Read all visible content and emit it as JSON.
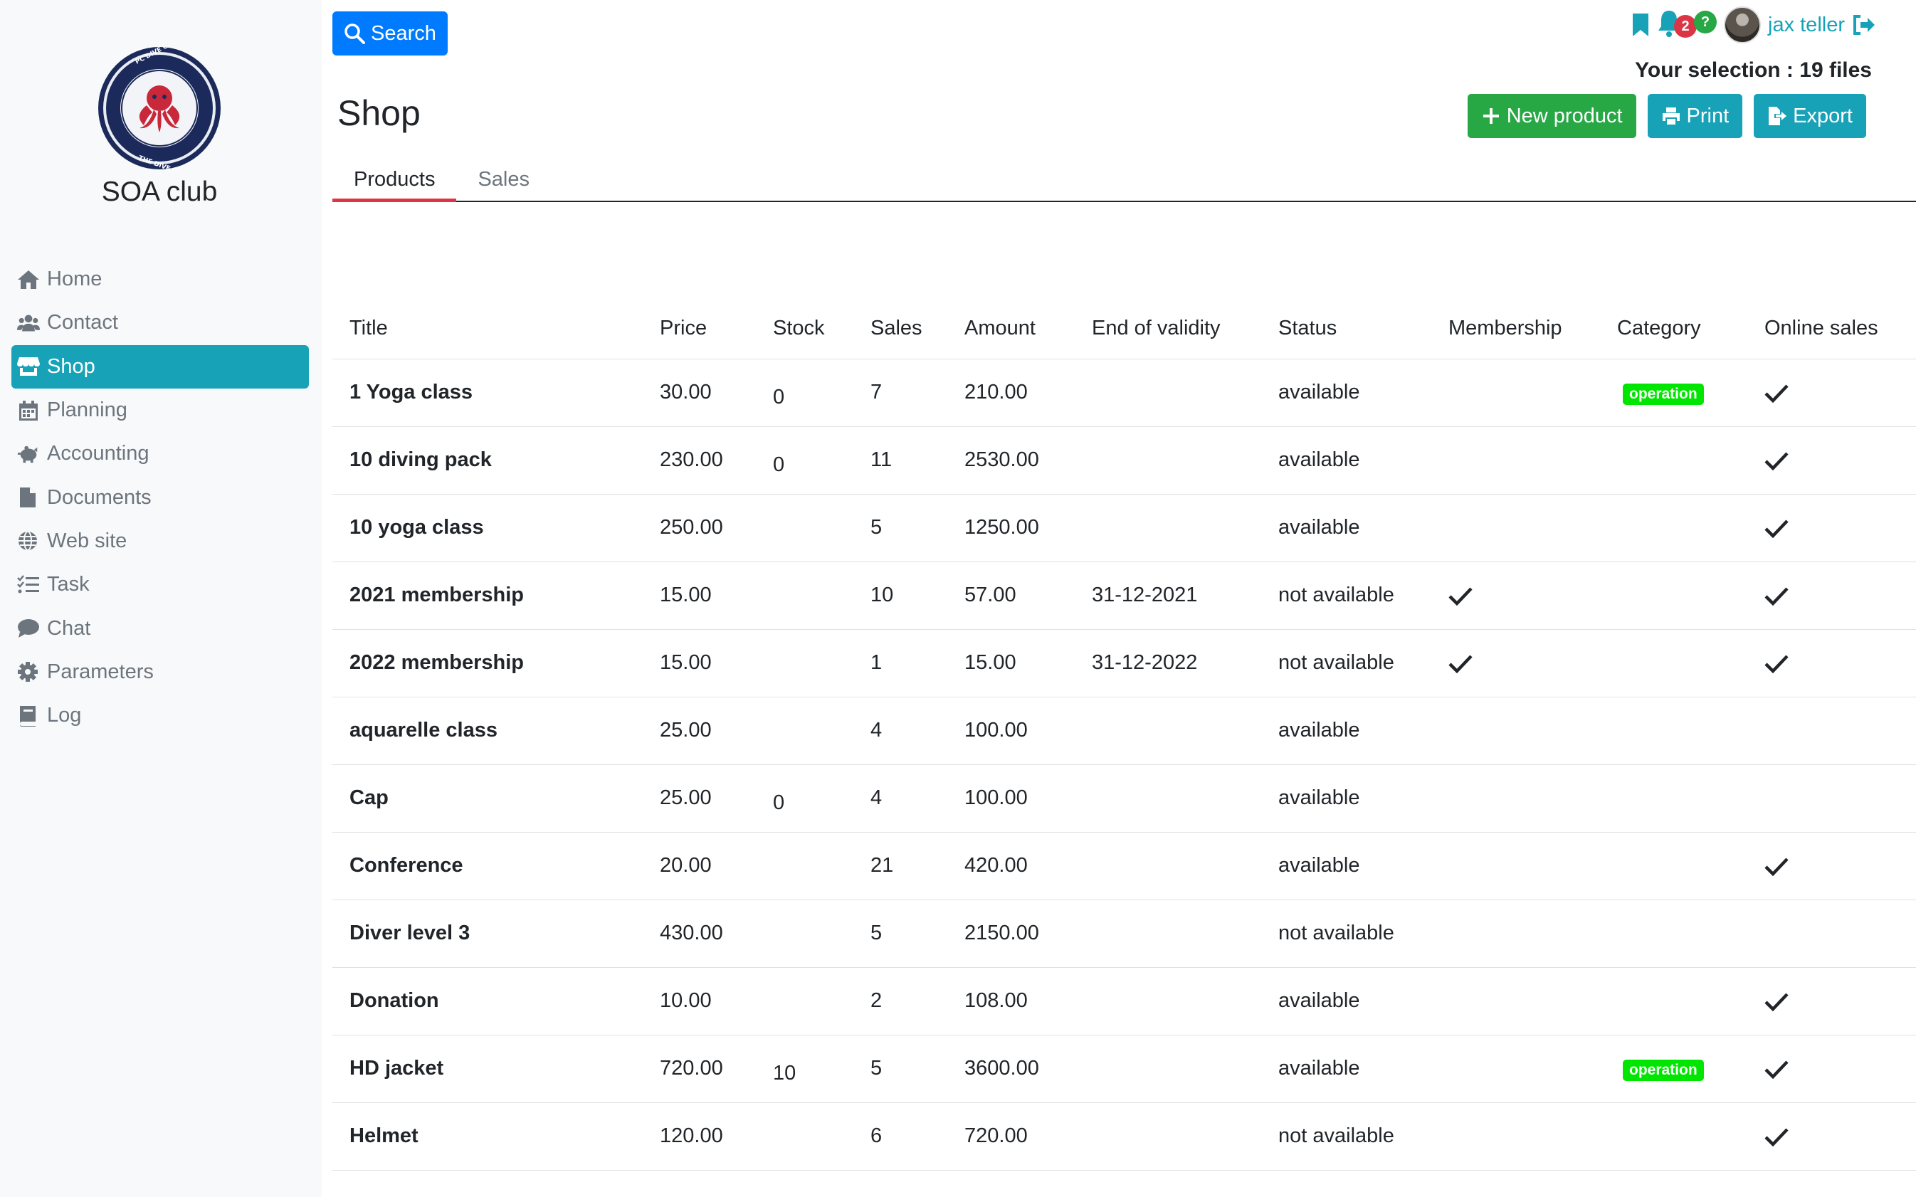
{
  "app": {
    "club_name": "SOA club"
  },
  "sidebar": {
    "items": [
      {
        "label": "Home",
        "icon": "home-icon",
        "active": false
      },
      {
        "label": "Contact",
        "icon": "users-icon",
        "active": false
      },
      {
        "label": "Shop",
        "icon": "store-icon",
        "active": true
      },
      {
        "label": "Planning",
        "icon": "calendar-icon",
        "active": false
      },
      {
        "label": "Accounting",
        "icon": "piggy-bank-icon",
        "active": false
      },
      {
        "label": "Documents",
        "icon": "file-icon",
        "active": false
      },
      {
        "label": "Web site",
        "icon": "globe-icon",
        "active": false
      },
      {
        "label": "Task",
        "icon": "tasks-icon",
        "active": false
      },
      {
        "label": "Chat",
        "icon": "comment-icon",
        "active": false
      },
      {
        "label": "Parameters",
        "icon": "gear-icon",
        "active": false
      },
      {
        "label": "Log",
        "icon": "book-icon",
        "active": false
      }
    ]
  },
  "header": {
    "search_label": "Search",
    "page_title": "Shop",
    "notification_count": "2",
    "help_label": "?",
    "user_name": "jax teller",
    "selection_text": "Your selection : 19 files",
    "actions": {
      "new_product": "New product",
      "print": "Print",
      "export": "Export"
    }
  },
  "tabs": [
    {
      "label": "Products",
      "active": true
    },
    {
      "label": "Sales",
      "active": false
    }
  ],
  "table": {
    "columns": [
      "Title",
      "Price",
      "Stock",
      "Sales",
      "Amount",
      "End of validity",
      "Status",
      "Membership",
      "Category",
      "Online sales"
    ],
    "rows": [
      {
        "title": "1 Yoga class",
        "price": "30.00",
        "stock": "0",
        "sales": "7",
        "amount": "210.00",
        "end": "",
        "status": "available",
        "membership": false,
        "category": "operation",
        "online": true
      },
      {
        "title": "10 diving pack",
        "price": "230.00",
        "stock": "0",
        "sales": "11",
        "amount": "2530.00",
        "end": "",
        "status": "available",
        "membership": false,
        "category": "",
        "online": true
      },
      {
        "title": "10 yoga class",
        "price": "250.00",
        "stock": "",
        "sales": "5",
        "amount": "1250.00",
        "end": "",
        "status": "available",
        "membership": false,
        "category": "",
        "online": true
      },
      {
        "title": "2021 membership",
        "price": "15.00",
        "stock": "",
        "sales": "10",
        "amount": "57.00",
        "end": "31-12-2021",
        "status": "not available",
        "membership": true,
        "category": "",
        "online": true
      },
      {
        "title": "2022 membership",
        "price": "15.00",
        "stock": "",
        "sales": "1",
        "amount": "15.00",
        "end": "31-12-2022",
        "status": "not available",
        "membership": true,
        "category": "",
        "online": true
      },
      {
        "title": "aquarelle class",
        "price": "25.00",
        "stock": "",
        "sales": "4",
        "amount": "100.00",
        "end": "",
        "status": "available",
        "membership": false,
        "category": "",
        "online": false
      },
      {
        "title": "Cap",
        "price": "25.00",
        "stock": "0",
        "sales": "4",
        "amount": "100.00",
        "end": "",
        "status": "available",
        "membership": false,
        "category": "",
        "online": false
      },
      {
        "title": "Conference",
        "price": "20.00",
        "stock": "",
        "sales": "21",
        "amount": "420.00",
        "end": "",
        "status": "available",
        "membership": false,
        "category": "",
        "online": true
      },
      {
        "title": "Diver level 3",
        "price": "430.00",
        "stock": "",
        "sales": "5",
        "amount": "2150.00",
        "end": "",
        "status": "not available",
        "membership": false,
        "category": "",
        "online": false
      },
      {
        "title": "Donation",
        "price": "10.00",
        "stock": "",
        "sales": "2",
        "amount": "108.00",
        "end": "",
        "status": "available",
        "membership": false,
        "category": "",
        "online": true
      },
      {
        "title": "HD jacket",
        "price": "720.00",
        "stock": "10",
        "sales": "5",
        "amount": "3600.00",
        "end": "",
        "status": "available",
        "membership": false,
        "category": "operation",
        "online": true
      },
      {
        "title": "Helmet",
        "price": "120.00",
        "stock": "",
        "sales": "6",
        "amount": "720.00",
        "end": "",
        "status": "not available",
        "membership": false,
        "category": "",
        "online": true
      }
    ]
  },
  "colors": {
    "primary": "#007bff",
    "teal": "#17a2b8",
    "green": "#28a745",
    "tab_underline": "#dc3545",
    "category_pill": "#00e600",
    "notif_badge": "#dc3545",
    "help_badge": "#28a745"
  }
}
